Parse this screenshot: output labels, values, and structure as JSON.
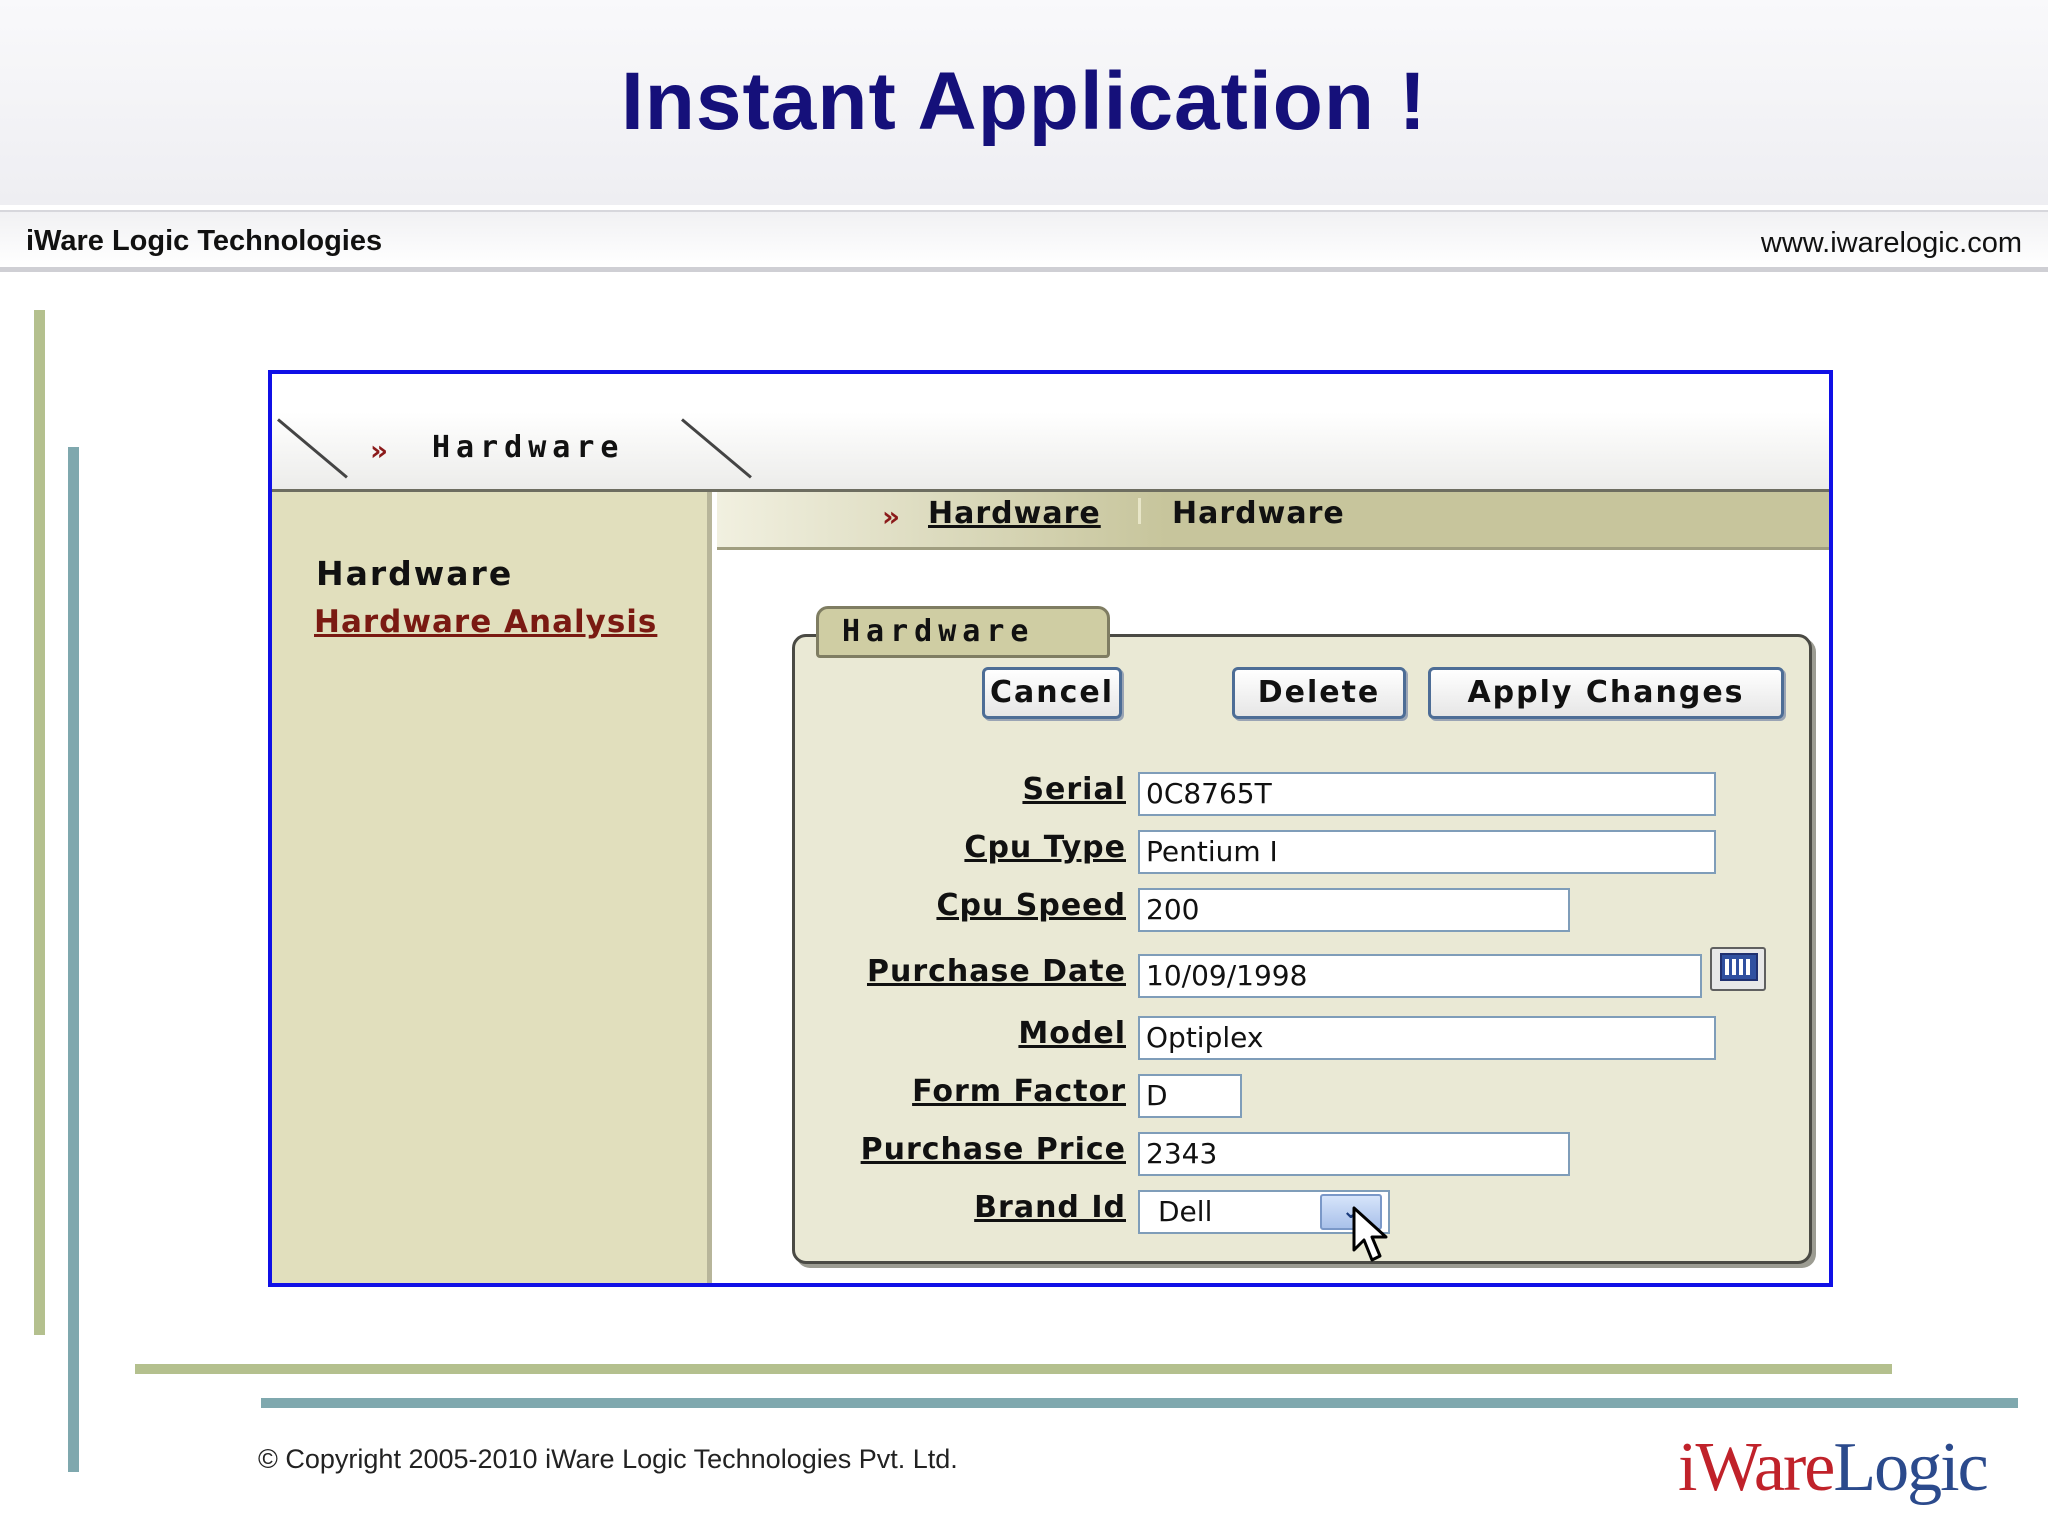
{
  "slide": {
    "title": "Instant Application !",
    "company": "iWare Logic Technologies",
    "website": "www.iwarelogic.com",
    "copyright": "© Copyright 2005-2010 iWare Logic Technologies Pvt. Ltd.",
    "logo_part1": "iWare",
    "logo_part2": "Logic"
  },
  "app": {
    "tab": {
      "arrow": "»",
      "label": "Hardware"
    },
    "breadcrumb": {
      "arrow": "»",
      "link": "Hardware",
      "current": "Hardware"
    },
    "sidebar": {
      "title": "Hardware",
      "link": "Hardware Analysis"
    },
    "region": {
      "title": "Hardware"
    },
    "buttons": {
      "cancel": "Cancel",
      "delete": "Delete",
      "apply": "Apply Changes"
    },
    "form": {
      "serial": {
        "label": "Serial",
        "value": "0C8765T"
      },
      "cpu_type": {
        "label": "Cpu Type",
        "value": "Pentium I"
      },
      "cpu_speed": {
        "label": "Cpu Speed",
        "value": "200"
      },
      "purchase_date": {
        "label": "Purchase Date",
        "value": "10/09/1998"
      },
      "model": {
        "label": "Model",
        "value": "Optiplex"
      },
      "form_factor": {
        "label": "Form Factor",
        "value": "D"
      },
      "purchase_price": {
        "label": "Purchase Price",
        "value": "2343"
      },
      "brand_id": {
        "label": "Brand Id",
        "value": "Dell"
      }
    }
  },
  "icons": {
    "calendar": "calendar-icon",
    "dropdown": "chevron-down-icon",
    "cursor": "mouse-pointer-icon"
  },
  "colors": {
    "title": "#15107a",
    "frame_border": "#1010e6",
    "accent_green": "#b4c08e",
    "accent_teal": "#7fa8ae",
    "sidebar_bg": "#e1dfbd",
    "link": "#7a1a12"
  }
}
